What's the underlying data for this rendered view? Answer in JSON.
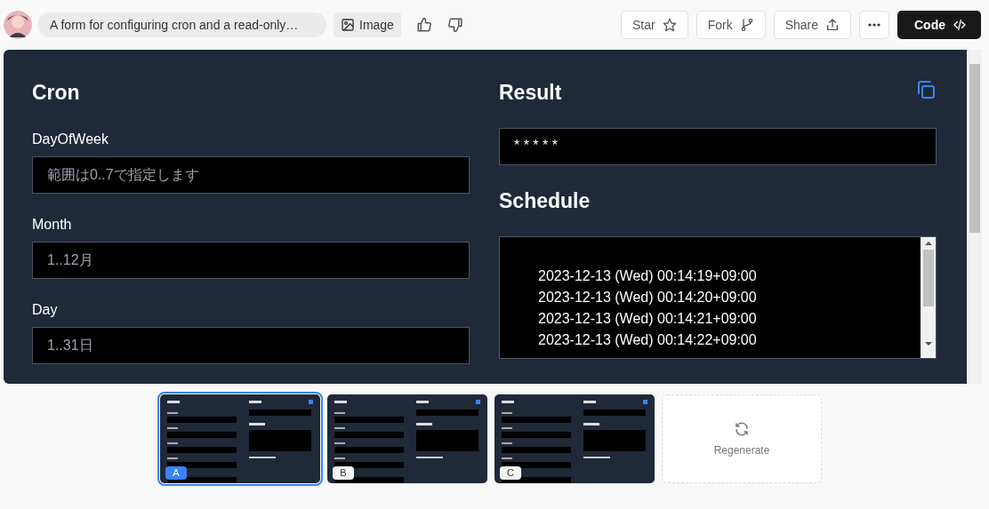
{
  "header": {
    "prompt": "A form for configuring cron and a read-only…",
    "image_button": "Image",
    "actions": [
      {
        "label": "Star",
        "kind": "star"
      },
      {
        "label": "Fork",
        "kind": "fork"
      },
      {
        "label": "Share",
        "kind": "share"
      }
    ],
    "code_button": "Code"
  },
  "preview": {
    "cron": {
      "title": "Cron",
      "fields": [
        {
          "label": "DayOfWeek",
          "placeholder": "範囲は0..7で指定します"
        },
        {
          "label": "Month",
          "placeholder": "1..12月"
        },
        {
          "label": "Day",
          "placeholder": "1..31日"
        }
      ]
    },
    "result": {
      "title": "Result",
      "value": "* * * * *"
    },
    "schedule": {
      "title": "Schedule",
      "lines": [
        "2023-12-13 (Wed) 00:14:19+09:00",
        "2023-12-13 (Wed) 00:14:20+09:00",
        "2023-12-13 (Wed) 00:14:21+09:00",
        "2023-12-13 (Wed) 00:14:22+09:00"
      ]
    }
  },
  "variants": [
    {
      "label": "A",
      "selected": true
    },
    {
      "label": "B",
      "selected": false
    },
    {
      "label": "C",
      "selected": false
    }
  ],
  "regenerate": "Regenerate"
}
